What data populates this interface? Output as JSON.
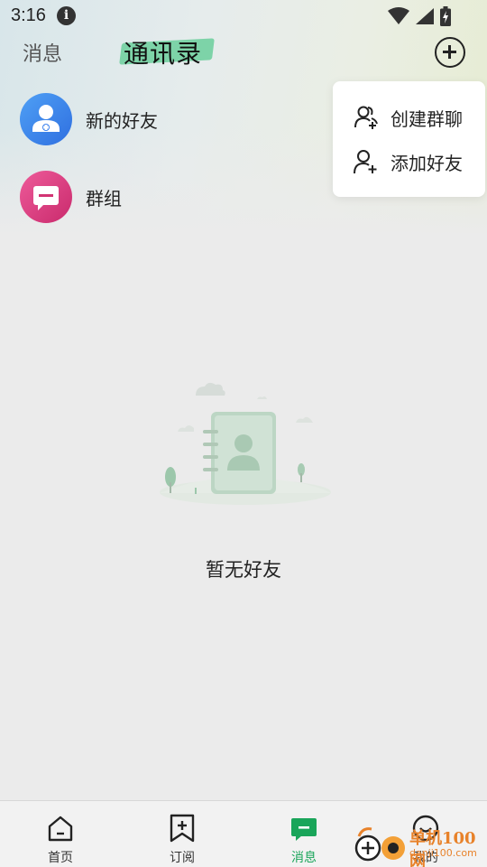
{
  "status_bar": {
    "time": "3:16"
  },
  "header": {
    "tab_messages": "消息",
    "tab_contacts": "通讯录"
  },
  "contacts": {
    "new_friends_label": "新的好友",
    "groups_label": "群组"
  },
  "dropdown_menu": {
    "items": [
      {
        "label": "创建群聊",
        "icon": "group-add-icon"
      },
      {
        "label": "添加好友",
        "icon": "person-add-icon"
      }
    ]
  },
  "empty_state": {
    "text": "暂无好友"
  },
  "bottom_nav": {
    "items": [
      {
        "label": "首页",
        "icon": "home-icon",
        "active": false
      },
      {
        "label": "订阅",
        "icon": "bookmark-add-icon",
        "active": false
      },
      {
        "label": "消息",
        "icon": "message-icon",
        "active": true
      },
      {
        "label": "我的",
        "icon": "smile-icon",
        "active": false
      }
    ]
  },
  "watermark": {
    "text": "单机100网",
    "sub": "danji100.com"
  },
  "colors": {
    "accent": "#1aa55a",
    "highlight": "#7dd3a8",
    "new_friend_avatar": "#3b82ee",
    "group_avatar": "#e0437f"
  }
}
